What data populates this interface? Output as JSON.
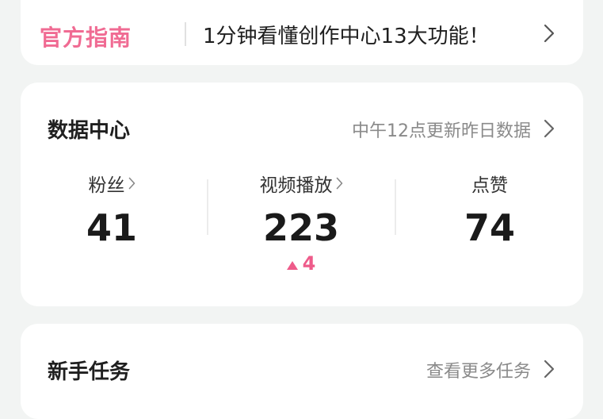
{
  "guide": {
    "badge": "官方指南",
    "text": "1分钟看懂创作中心13大功能！"
  },
  "data_center": {
    "title": "数据中心",
    "update_note": "中午12点更新昨日数据",
    "stats": [
      {
        "label": "粉丝",
        "value": "41",
        "has_arrow": true
      },
      {
        "label": "视频播放",
        "value": "223",
        "has_arrow": true,
        "delta": "4"
      },
      {
        "label": "点赞",
        "value": "74",
        "has_arrow": false
      }
    ]
  },
  "tasks": {
    "title": "新手任务",
    "more_link": "查看更多任务"
  },
  "colors": {
    "accent_pink": "#f06b93",
    "delta_pink": "#ee5b8a",
    "background": "#f2f4f3"
  }
}
